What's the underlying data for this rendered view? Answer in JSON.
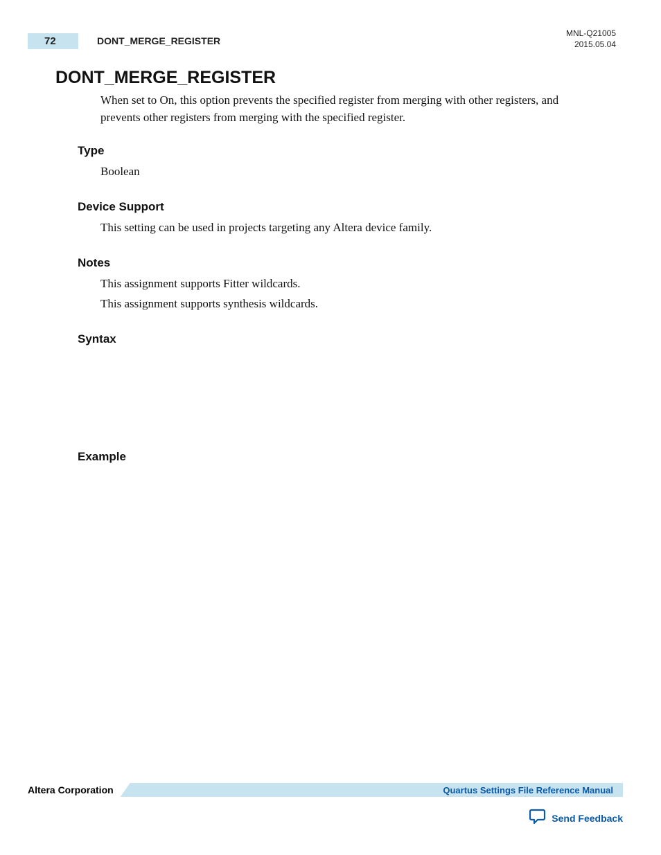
{
  "header": {
    "page_number": "72",
    "title": "DONT_MERGE_REGISTER",
    "doc_id": "MNL-Q21005",
    "date": "2015.05.04"
  },
  "main": {
    "heading": "DONT_MERGE_REGISTER",
    "intro": "When set to On, this option prevents the specified register from merging with other registers, and prevents other registers from merging with the specified register.",
    "sections": {
      "type": {
        "label": "Type",
        "text": "Boolean"
      },
      "device_support": {
        "label": "Device Support",
        "text": "This setting can be used in projects targeting any Altera device family."
      },
      "notes": {
        "label": "Notes",
        "line1": "This assignment supports Fitter wildcards.",
        "line2": "This assignment supports synthesis wildcards."
      },
      "syntax": {
        "label": "Syntax"
      },
      "example": {
        "label": "Example"
      }
    }
  },
  "footer": {
    "company": "Altera Corporation",
    "manual_link": "Quartus Settings File Reference Manual",
    "feedback": "Send Feedback"
  }
}
